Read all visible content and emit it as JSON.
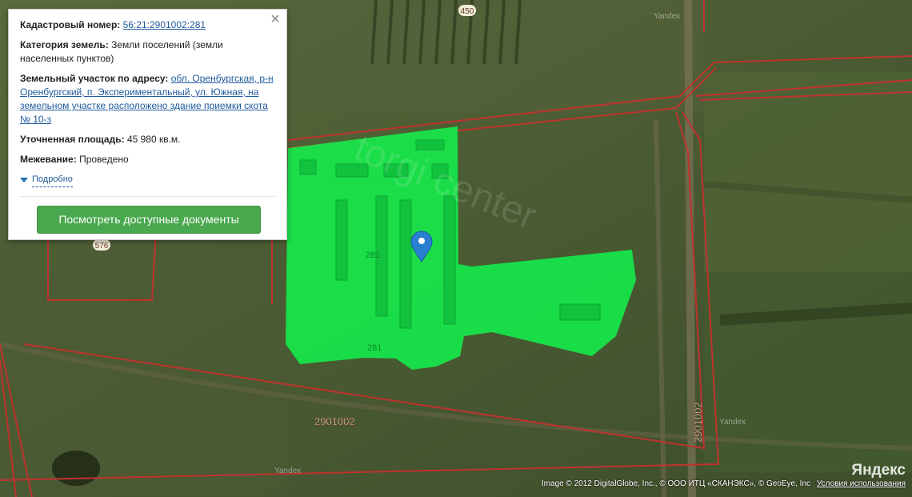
{
  "popup": {
    "cadastral_label": "Кадастровый номер:",
    "cadastral_value": "56:21:2901002:281",
    "category_label": "Категория земель:",
    "category_value": "Земли поселений (земли населенных пунктов)",
    "address_label": "Земельный участок по адресу:",
    "address_value": "обл. Оренбургская, р-н Оренбургский, п. Экспериментальный, ул. Южная, на земельном участке расположено здание приемки скота № 10-з",
    "area_label": "Уточненная площадь:",
    "area_value": "45 980 кв.м.",
    "survey_label": "Межевание:",
    "survey_value": "Проведено",
    "more_label": "Подробно",
    "docs_button": "Посмотреть доступные документы",
    "close_icon": "close-icon"
  },
  "map_labels": {
    "road_450": "450",
    "road_576": "576",
    "parcel_281_a": "281",
    "parcel_281_b": "281",
    "quarter_left": "2901002",
    "quarter_right": "2901002",
    "watermark": "torgi center",
    "yandex_wm": "Yandex"
  },
  "attribution": {
    "text": "Image © 2012 DigitalGlobe, Inc., © ООО ИТЦ «СКАНЭКС», © GeoEye, Inc",
    "terms": "Условия использования",
    "logo": "Яндекс"
  },
  "colors": {
    "parcel_fill": "#16e84a",
    "boundary": "#c0322e",
    "pin": "#2a7fd0",
    "button": "#4aa84f"
  }
}
